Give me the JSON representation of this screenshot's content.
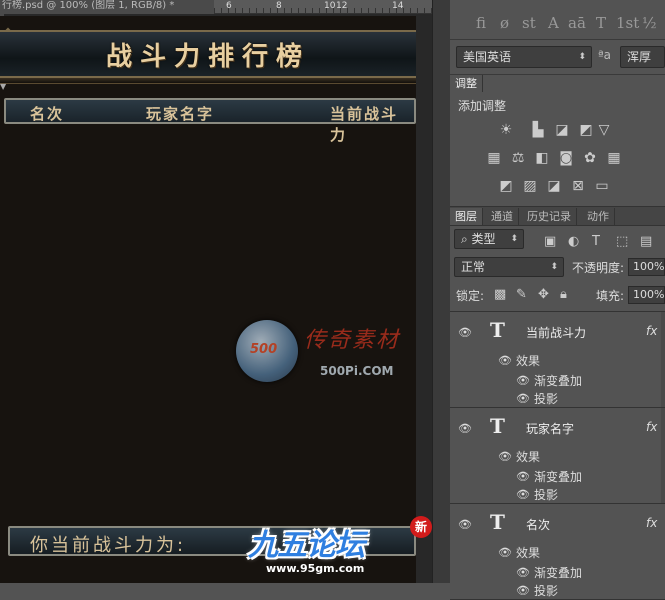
{
  "document": {
    "tab_title": "行榜.psd @ 100% (图层 1, RGB/8) *",
    "ruler_ticks": [
      "6",
      "8",
      "10",
      "12",
      "14"
    ]
  },
  "design": {
    "title": "战斗力排行榜",
    "columns": [
      "名次",
      "玩家名字",
      "当前战斗力"
    ],
    "footer_label": "你当前战斗力为:",
    "watermark": {
      "cn": "传奇素材",
      "en": "500Pi.COM"
    },
    "forum_logo": {
      "name": "九五论坛",
      "url": "www.95gm.com",
      "badge": "新"
    }
  },
  "character_panel": {
    "glyphs": [
      "fi",
      "ø",
      "st",
      "A",
      "aā",
      "T",
      "1st",
      "½"
    ],
    "language": "美国英语",
    "aa_label": "ªa",
    "aa_mode": "浑厚"
  },
  "adjustments_panel": {
    "tab": "调整",
    "subtitle": "添加调整",
    "icons_row1": [
      "brightness-icon",
      "levels-icon",
      "curves-icon",
      "exposure-icon",
      "vibrance-icon"
    ],
    "icons_row2": [
      "hue-icon",
      "balance-icon",
      "bw-icon",
      "photo-filter-icon",
      "channel-mixer-icon",
      "color-lookup-icon"
    ],
    "icons_row3": [
      "invert-icon",
      "posterize-icon",
      "threshold-icon",
      "selective-color-icon",
      "gradient-map-icon"
    ]
  },
  "layers_panel": {
    "tabs": [
      "图层",
      "通道",
      "历史记录",
      "动作"
    ],
    "filter_label": "类型",
    "blend_mode": "正常",
    "opacity_label": "不透明度:",
    "opacity_value": "100%",
    "lock_label": "锁定:",
    "fill_label": "填充:",
    "fill_value": "100%",
    "layers": [
      {
        "name": "当前战斗力",
        "fx": "fx",
        "effects_label": "效果",
        "effects": [
          "渐变叠加",
          "投影"
        ]
      },
      {
        "name": "玩家名字",
        "fx": "fx",
        "effects_label": "效果",
        "effects": [
          "渐变叠加",
          "投影"
        ]
      },
      {
        "name": "名次",
        "fx": "fx",
        "effects_label": "效果",
        "effects": [
          "渐变叠加",
          "投影"
        ]
      }
    ]
  }
}
